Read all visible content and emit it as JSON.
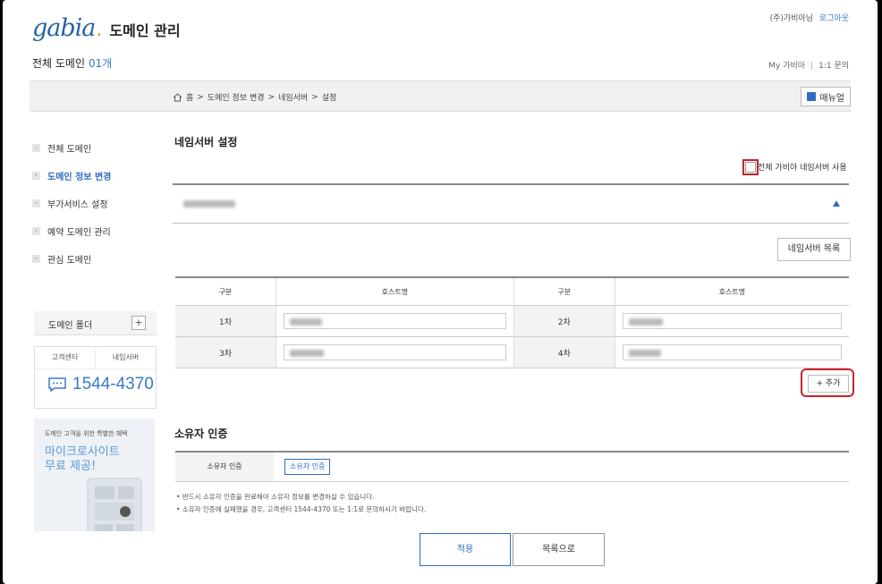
{
  "header": {
    "logo_word": "gabia",
    "title": "도메인 관리",
    "user_text": "(주)가비아님",
    "logout_label": "로그아웃",
    "domain_count_label": "전체 도메인",
    "domain_count": "01개",
    "my_gabia_label": "My 가비아",
    "one_on_one_label": "1:1 문의"
  },
  "breadcrumb": {
    "items": [
      "홈",
      ">",
      "도메인 정보 변경",
      ">",
      "네임서버",
      ">",
      "설정"
    ]
  },
  "manual_label": "매뉴얼",
  "sidebar": {
    "items": [
      {
        "label": "전체 도메인",
        "active": false
      },
      {
        "label": "도메인 정보 변경",
        "active": true
      },
      {
        "label": "부가서비스 설정",
        "active": false
      },
      {
        "label": "예약 도메인 관리",
        "active": false
      },
      {
        "label": "관심 도메인",
        "active": false
      }
    ],
    "folder_label": "도메인 폴더",
    "cs_tab_1": "고객센터",
    "cs_tab_2": "네임서버",
    "phone": "1544-4370",
    "promo_small": "도메인 고객을 위한 특별한 혜택",
    "promo_line1": "마이크로사이트",
    "promo_line2": "무료 제공!"
  },
  "nameserver": {
    "title": "네임서버 설정",
    "use_all_label": "전체 가비아 네임서버 사용",
    "list_button": "네임서버 목록",
    "col_gubun": "구분",
    "col_host": "호스트명",
    "rows": [
      {
        "left_label": "1차",
        "right_label": "2차"
      },
      {
        "left_label": "3차",
        "right_label": "4차"
      }
    ],
    "add_button": "+ 추가"
  },
  "owner": {
    "title": "소유자 인증",
    "label": "소유자 인증",
    "button": "소유자 인증",
    "notes": [
      "반드시 소유자 인증을 완료해야 소유자 정보를 변경하실 수 있습니다.",
      "소유자 인증에 실패했을 경우, 고객센터 1544-4370 또는 1:1로 문의하시기 바랍니다."
    ]
  },
  "actions": {
    "apply": "적용",
    "back_to_list": "목록으로"
  },
  "colors": {
    "brand_blue": "#2f6cc4",
    "highlight_red": "#c8232c"
  }
}
